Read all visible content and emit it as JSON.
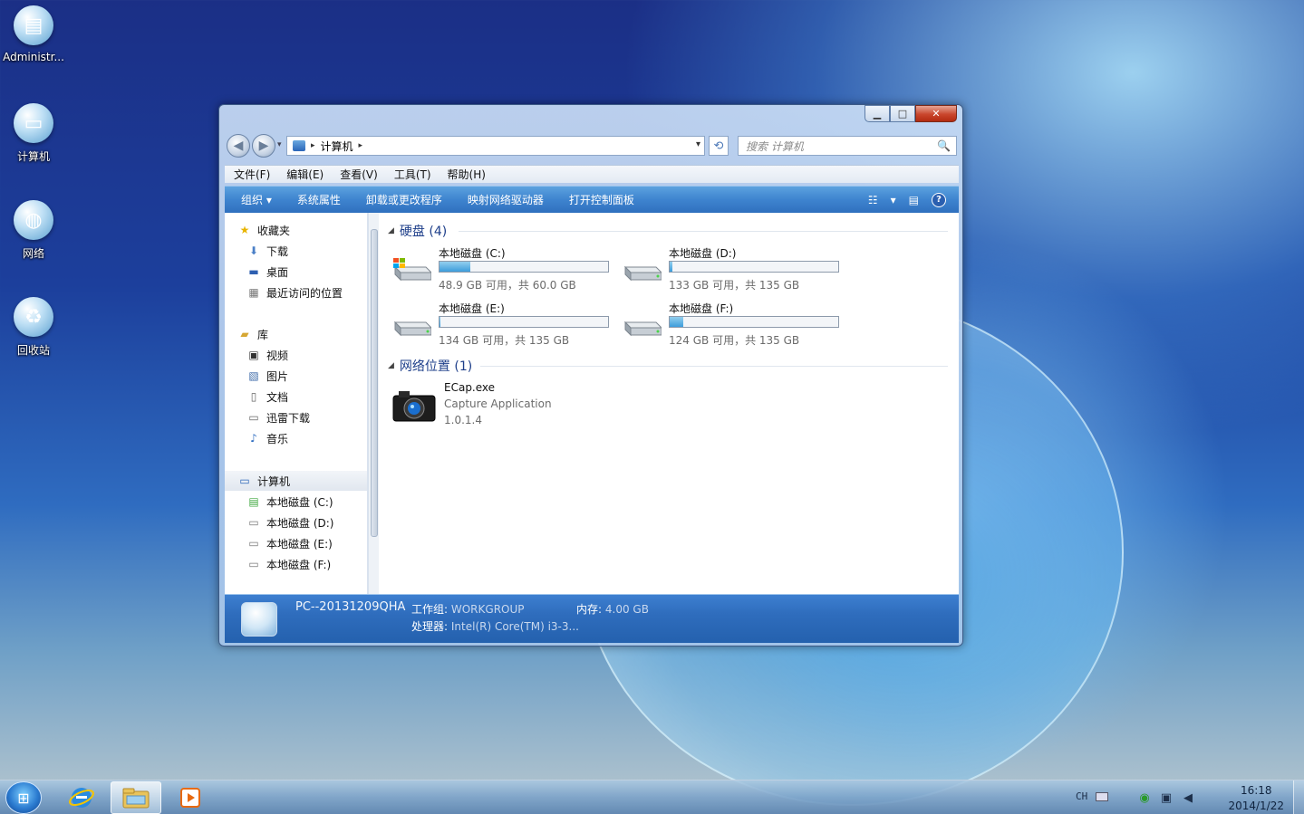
{
  "desktop": {
    "icons": [
      {
        "label": "Administr...",
        "icon": "user-folder-icon"
      },
      {
        "label": "计算机",
        "icon": "computer-icon"
      },
      {
        "label": "网络",
        "icon": "network-icon"
      },
      {
        "label": "回收站",
        "icon": "recycle-bin-icon"
      }
    ]
  },
  "window": {
    "caption_buttons": {
      "minimize": "▁",
      "maximize": "□",
      "close": "✕"
    },
    "nav": {
      "back": "◀",
      "forward": "▶",
      "history": "▾"
    },
    "address": {
      "crumb_sep": "▸",
      "location": "计算机",
      "dropdown": "▾"
    },
    "search": {
      "placeholder": "搜索 计算机",
      "icon": "🔍"
    },
    "refresh_symbol": "⟲",
    "menu": [
      "文件(F)",
      "编辑(E)",
      "查看(V)",
      "工具(T)",
      "帮助(H)"
    ],
    "commands": [
      "组织 ▾",
      "系统属性",
      "卸载或更改程序",
      "映射网络驱动器",
      "打开控制面板"
    ],
    "view_controls": {
      "views": "☷",
      "views_dropdown": "▾",
      "preview": "▤",
      "help": "?"
    },
    "sidebar": {
      "favorites": {
        "label": "收藏夹",
        "items": [
          "下载",
          "桌面",
          "最近访问的位置"
        ]
      },
      "libraries": {
        "label": "库",
        "items": [
          "视频",
          "图片",
          "文档",
          "迅雷下载",
          "音乐"
        ]
      },
      "computer": {
        "label": "计算机",
        "items": [
          "本地磁盘 (C:)",
          "本地磁盘 (D:)",
          "本地磁盘 (E:)",
          "本地磁盘 (F:)"
        ]
      }
    },
    "sections": {
      "drives_header": "硬盘 (4)",
      "network_header": "网络位置 (1)"
    },
    "drives": [
      {
        "name": "本地磁盘 (C:)",
        "free_text": "48.9 GB 可用，共 60.0 GB",
        "used_fraction": 0.185,
        "system": true
      },
      {
        "name": "本地磁盘 (D:)",
        "free_text": "133 GB 可用，共 135 GB",
        "used_fraction": 0.015,
        "system": false
      },
      {
        "name": "本地磁盘 (E:)",
        "free_text": "134 GB 可用，共 135 GB",
        "used_fraction": 0.007,
        "system": false
      },
      {
        "name": "本地磁盘 (F:)",
        "free_text": "124 GB 可用，共 135 GB",
        "used_fraction": 0.081,
        "system": false
      }
    ],
    "network_items": [
      {
        "name": "ECap.exe",
        "description": "Capture Application",
        "version": "1.0.1.4"
      }
    ],
    "details": {
      "pc_name": "PC--20131209QHA",
      "workgroup_key": "工作组:",
      "workgroup_val": "WORKGROUP",
      "memory_key": "内存:",
      "memory_val": "4.00 GB",
      "cpu_key": "处理器:",
      "cpu_val": "Intel(R) Core(TM) i3-3..."
    }
  },
  "taskbar": {
    "start_symbol": "⊞",
    "lang": "CH",
    "tray_icons": [
      "security-icon",
      "network-tray-icon",
      "volume-icon"
    ],
    "time": "16:18",
    "date": "2014/1/22"
  },
  "colors": {
    "accent": "#3e84cf",
    "header_text": "#1e3f8a",
    "bar_fill": "#3d9ddb"
  }
}
